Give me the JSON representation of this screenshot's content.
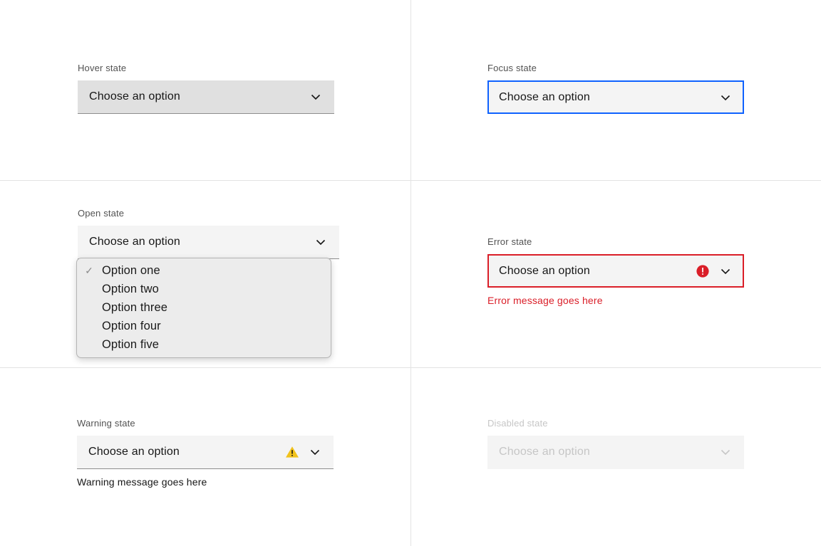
{
  "states": {
    "hover": {
      "label": "Hover state",
      "value": "Choose an option"
    },
    "focus": {
      "label": "Focus state",
      "value": "Choose an option"
    },
    "open": {
      "label": "Open state",
      "value": "Choose an option"
    },
    "error": {
      "label": "Error state",
      "value": "Choose an option",
      "message": "Error message goes here"
    },
    "warning": {
      "label": "Warning state",
      "value": "Choose an option",
      "message": "Warning message goes here"
    },
    "disabled": {
      "label": "Disabled state",
      "value": "Choose an option"
    }
  },
  "dropdown": {
    "selected": "Option one",
    "options": [
      {
        "label": "Option one",
        "checked": true
      },
      {
        "label": "Option two",
        "checked": false
      },
      {
        "label": "Option three",
        "checked": false
      },
      {
        "label": "Option four",
        "checked": false
      },
      {
        "label": "Option five",
        "checked": false
      }
    ],
    "check_glyph": "✓"
  },
  "icons": {
    "chevron": "chevron-down-icon",
    "error": "error-filled-icon",
    "warning": "warning-filled-icon"
  },
  "colors": {
    "focus_border": "#0f62fe",
    "error": "#da1e28",
    "warning": "#f1c21b",
    "field_bg": "#f4f4f4",
    "hover_bg": "#e0e0e0",
    "label": "#525252",
    "disabled_text": "#c6c6c6",
    "grid_line": "#e3e3e3"
  }
}
